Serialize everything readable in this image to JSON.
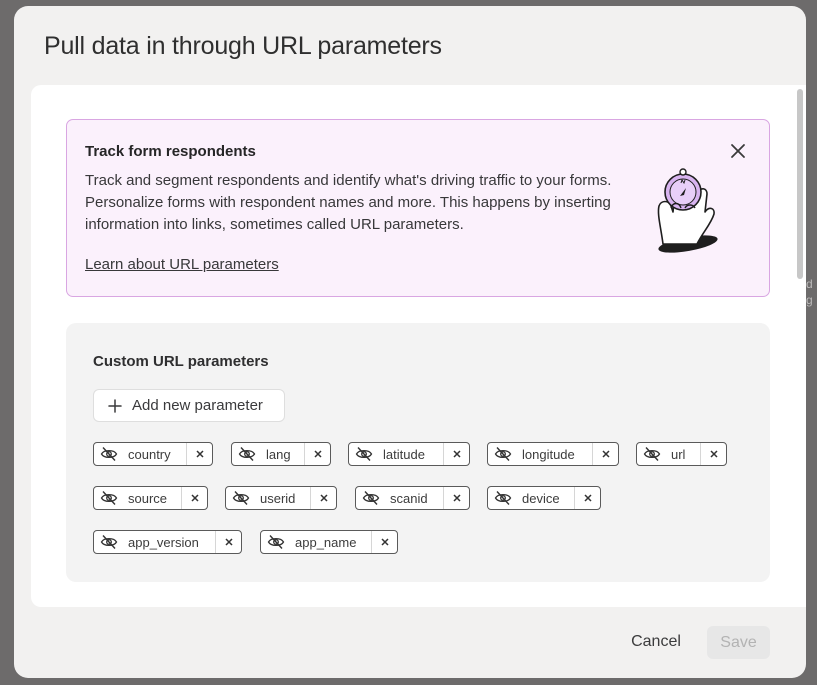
{
  "dialog": {
    "title": "Pull data in through URL parameters",
    "cancel_label": "Cancel",
    "save_label": "Save"
  },
  "banner": {
    "title": "Track form respondents",
    "text": "Track and segment respondents and identify what's driving traffic to your forms. Personalize forms with respondent names and more. This happens by inserting information into links, sometimes called URL parameters.",
    "link_label": "Learn about URL parameters",
    "close_icon": "close-icon",
    "illustration": "hand-holding-compass"
  },
  "params": {
    "title": "Custom URL parameters",
    "add_label": "Add new parameter",
    "items": [
      {
        "label": "country",
        "icon": "eye-off-icon",
        "hidden": true
      },
      {
        "label": "lang",
        "icon": "eye-off-icon",
        "hidden": true
      },
      {
        "label": "latitude",
        "icon": "eye-off-icon",
        "hidden": true
      },
      {
        "label": "longitude",
        "icon": "eye-off-icon",
        "hidden": true
      },
      {
        "label": "url",
        "icon": "eye-off-icon",
        "hidden": true
      },
      {
        "label": "source",
        "icon": "eye-off-icon",
        "hidden": true
      },
      {
        "label": "userid",
        "icon": "eye-off-icon",
        "hidden": true
      },
      {
        "label": "scanid",
        "icon": "eye-off-icon",
        "hidden": true
      },
      {
        "label": "device",
        "icon": "eye-off-icon",
        "hidden": true
      },
      {
        "label": "app_version",
        "icon": "eye-off-icon",
        "hidden": true
      },
      {
        "label": "app_name",
        "icon": "eye-off-icon",
        "hidden": true
      }
    ]
  },
  "colors": {
    "banner_bg": "#fbf1fc",
    "banner_border": "#d9a6e2",
    "illustration_accent": "#d8b4f0",
    "save_disabled_bg": "#e7e7e7"
  }
}
